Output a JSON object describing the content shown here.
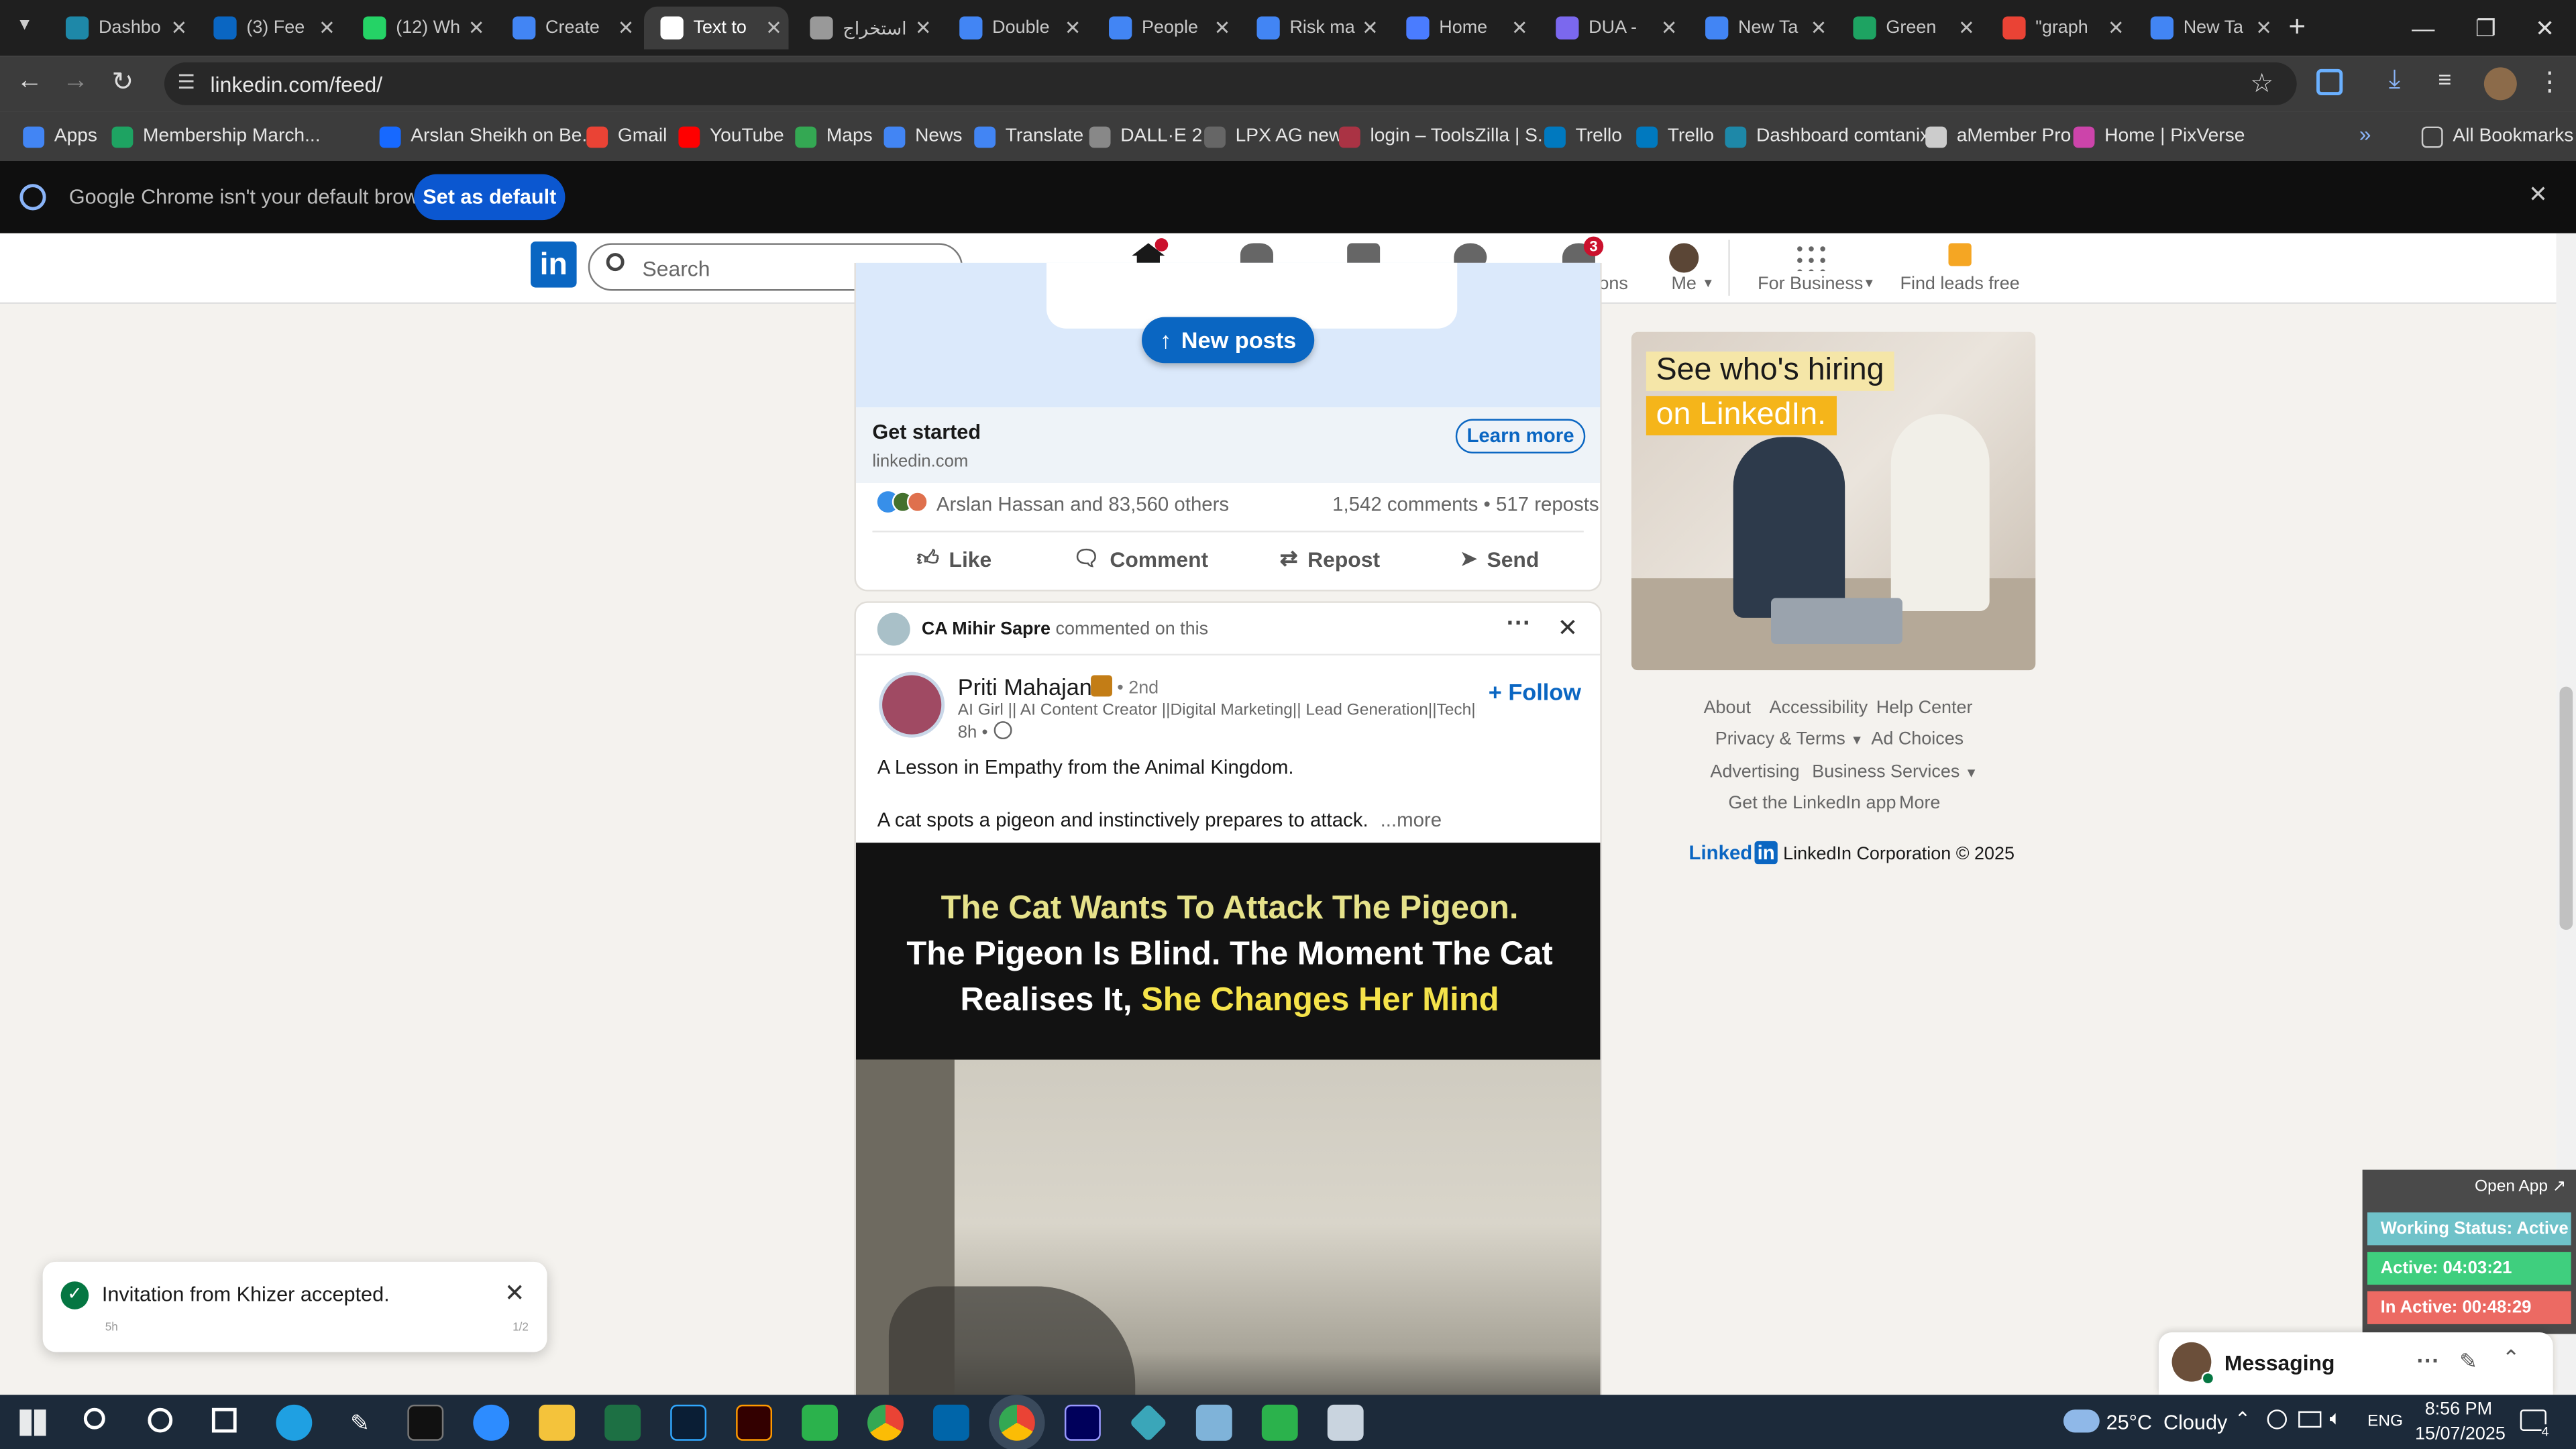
{
  "browser": {
    "tabs": [
      {
        "label": "Dashbo",
        "color": "#1e88a8"
      },
      {
        "label": "(3) Fee",
        "color": "#0a66c2"
      },
      {
        "label": "(12) Wh",
        "color": "#25d366"
      },
      {
        "label": "Create",
        "color": "#4285f4"
      },
      {
        "label": "Text to",
        "color": "#ffffff"
      },
      {
        "label": "استخراج",
        "color": "#999999"
      },
      {
        "label": "Double",
        "color": "#4285f4"
      },
      {
        "label": "People",
        "color": "#4285f4"
      },
      {
        "label": "Risk ma",
        "color": "#4285f4"
      },
      {
        "label": "Home",
        "color": "#4a7cff"
      },
      {
        "label": "DUA -",
        "color": "#7b68ee"
      },
      {
        "label": "New Ta",
        "color": "#4285f4"
      },
      {
        "label": "Green",
        "color": "#1ea362"
      },
      {
        "label": "\"graph",
        "color": "#ea4335"
      },
      {
        "label": "New Ta",
        "color": "#4285f4"
      }
    ],
    "url": "linkedin.com/feed/",
    "bookmarks": [
      {
        "label": "Apps",
        "color": "#4285f4"
      },
      {
        "label": "Membership March...",
        "color": "#1ea362"
      },
      {
        "label": "Arslan Sheikh on Be...",
        "color": "#1769ff"
      },
      {
        "label": "Gmail",
        "color": "#ea4335"
      },
      {
        "label": "YouTube",
        "color": "#ff0000"
      },
      {
        "label": "Maps",
        "color": "#34a853"
      },
      {
        "label": "News",
        "color": "#4285f4"
      },
      {
        "label": "Translate",
        "color": "#4285f4"
      },
      {
        "label": "DALL·E 2",
        "color": "#888888"
      },
      {
        "label": "LPX AG new",
        "color": "#666666"
      },
      {
        "label": "login – ToolsZilla | S...",
        "color": "#aa3344"
      },
      {
        "label": "Trello",
        "color": "#0079bf"
      },
      {
        "label": "Trello",
        "color": "#0079bf"
      },
      {
        "label": "Dashboard comtanix",
        "color": "#1e88a8"
      },
      {
        "label": "aMember Pro",
        "color": "#cccccc"
      },
      {
        "label": "Home | PixVerse",
        "color": "#cc44aa"
      }
    ],
    "all_bookmarks": "All Bookmarks",
    "infobar_text": "Google Chrome isn't your default browser",
    "infobar_button": "Set as default"
  },
  "linkedin": {
    "search_placeholder": "Search",
    "nav": [
      {
        "label": "Home",
        "badge": ""
      },
      {
        "label": "My Network",
        "badge": ""
      },
      {
        "label": "Jobs",
        "badge": ""
      },
      {
        "label": "Messaging",
        "badge": ""
      },
      {
        "label": "Notifications",
        "badge": "3"
      },
      {
        "label": "Me",
        "badge": ""
      },
      {
        "label": "For Business",
        "badge": ""
      },
      {
        "label": "Find leads free",
        "badge": ""
      }
    ],
    "new_posts_label": "New posts",
    "post1": {
      "cta_title": "Get started",
      "cta_domain": "linkedin.com",
      "cta_button": "Learn more",
      "reactions_text": "Arslan Hassan and 83,560 others",
      "comments_reposts": "1,542 comments • 517 reposts",
      "actions": [
        "Like",
        "Comment",
        "Repost",
        "Send"
      ]
    },
    "post2": {
      "commenter": "CA Mihir Sapre",
      "commented_text": "commented on this",
      "author_name": "Priti Mahajan",
      "degree": "• 2nd",
      "headline": "AI Girl || AI Content Creator ||Digital Marketing|| Lead Generation||Tech||...",
      "time": "8h •",
      "follow_label": "Follow",
      "text_line1": "A Lesson in Empathy from the Animal Kingdom.",
      "text_line2": "A cat spots a pigeon and instinctively prepares to attack.",
      "more_label": "...more",
      "video_caption_white1": "The Cat Wants To Attack The Pigeon.",
      "video_caption_white2": "The Pigeon Is Blind. The Moment The Cat",
      "video_caption_white3": "Realises It,",
      "video_caption_yellow": "She Changes Her Mind"
    },
    "ad": {
      "line1": "See who's hiring",
      "line2": "on LinkedIn."
    },
    "footer": {
      "about": "About",
      "accessibility": "Accessibility",
      "help_center": "Help Center",
      "privacy_terms": "Privacy & Terms",
      "ad_choices": "Ad Choices",
      "advertising": "Advertising",
      "business_services": "Business Services",
      "get_app": "Get the LinkedIn app",
      "more": "More",
      "logo_text": "Linked",
      "copyright": "LinkedIn Corporation © 2025"
    },
    "toast": {
      "message": "Invitation from Khizer accepted.",
      "time": "5h",
      "page": "1/2"
    },
    "messaging_label": "Messaging"
  },
  "tracker": {
    "open_app": "Open App ↗",
    "status": "Working Status: Active",
    "active": "Active: 04:03:21",
    "inactive": "In Active: 00:48:29"
  },
  "taskbar": {
    "weather": "25°C  Cloudy",
    "lang": "ENG",
    "time": "8:56 PM",
    "date": "15/07/2025",
    "notification_count": "4"
  }
}
